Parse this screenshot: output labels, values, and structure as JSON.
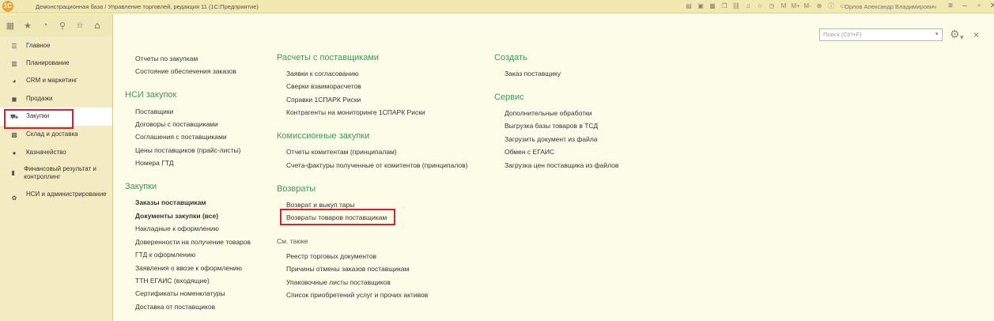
{
  "window": {
    "title": "Демонстрационная база / Управление торговлей, редакция 11 (1С:Предприятие)",
    "user": "Орлов Александр Владимирович",
    "logo": "1С"
  },
  "search": {
    "placeholder": "Поиск (Ctrl+F)"
  },
  "sidebar": {
    "items": [
      {
        "label": "Главное",
        "icon": "menu-lines-icon"
      },
      {
        "label": "Планирование",
        "icon": "chart-bars-icon"
      },
      {
        "label": "CRM и маркетинг",
        "icon": "pie-icon"
      },
      {
        "label": "Продажи",
        "icon": "bag-icon"
      },
      {
        "label": "Закупки",
        "icon": "cart-icon"
      },
      {
        "label": "Склад и доставка",
        "icon": "warehouse-icon"
      },
      {
        "label": "Казначейство",
        "icon": "coin-icon"
      },
      {
        "label": "Финансовый результат и контроллинг",
        "icon": "bar-chart-icon"
      },
      {
        "label": "НСИ и администрирование",
        "icon": "gear-icon"
      }
    ]
  },
  "col1": {
    "top_links": [
      "Отчеты по закупкам",
      "Состояние обеспечения заказов"
    ],
    "nsi_title": "НСИ закупок",
    "nsi_links": [
      "Поставщики",
      "Договоры с поставщиками",
      "Соглашения с поставщиками",
      "Цены поставщиков (прайс-листы)",
      "Номера ГТД"
    ],
    "zakupki_title": "Закупки",
    "zakupki_links": [
      "Заказы поставщикам",
      "Документы закупки (все)",
      "Накладные к оформлению",
      "Доверенности на получение товаров",
      "ГТД к оформлению",
      "Заявления о ввозе к оформлению",
      "ТТН ЕГАИС (входящие)",
      "Сертификаты номенклатуры",
      "Доставка от поставщиков"
    ]
  },
  "col2": {
    "raschety_title": "Расчеты с поставщиками",
    "raschety_links": [
      "Заявки к согласованию",
      "Сверки взаиморасчетов",
      "Справки 1СПАРК Риски",
      "Контрагенты на мониторинге 1СПАРК Риски"
    ],
    "komis_title": "Комиссионные закупки",
    "komis_links": [
      "Отчеты комитентам (принципалам)",
      "Счета-фактуры полученные от комитентов (принципалов)"
    ],
    "vozvraty_title": "Возвраты",
    "vozvraty_links": [
      "Возврат и выкуп тары",
      "Возвраты товаров поставщикам"
    ],
    "see_also_title": "См. также",
    "see_also_links": [
      "Реестр торговых документов",
      "Причины отмены заказов поставщикам",
      "Упаковочные листы поставщиков",
      "Список приобретений услуг и прочих активов"
    ]
  },
  "col3": {
    "create_title": "Создать",
    "create_links": [
      "Заказ поставщику"
    ],
    "service_title": "Сервис",
    "service_links": [
      "Дополнительные обработки",
      "Выгрузка базы товаров в ТСД",
      "Загрузить документ из файла",
      "Обмен с ЕГАИС",
      "Загрузка цен поставщика из файлов"
    ]
  }
}
